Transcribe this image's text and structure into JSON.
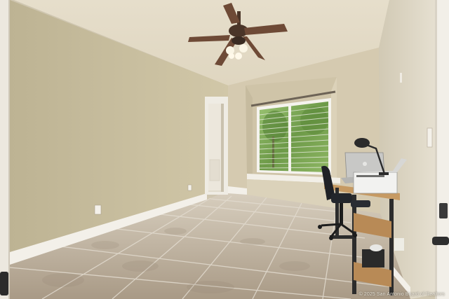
{
  "photo": {
    "watermark": "© 2025 San Antonio Board of Realtors"
  },
  "palette": {
    "wall_left": "#c9bf9f",
    "wall_back": "#d4c9ad",
    "wall_right": "#dcd5c4",
    "ceiling": "#e4dcc8",
    "baseboard": "#f4f1ea",
    "floor_tile": "#b7aa98",
    "grout": "#d6cfc3",
    "window_green": "#7fa85a",
    "fan_wood": "#6e4a36"
  }
}
